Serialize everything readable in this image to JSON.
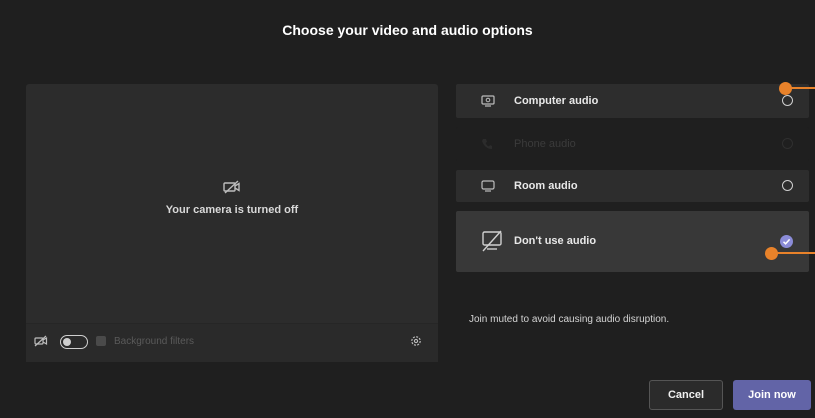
{
  "dialog": {
    "title": "Choose your video and audio options"
  },
  "preview": {
    "camera_status": "Your camera is turned off",
    "background_filter_label": "Background filters"
  },
  "audio_options": [
    {
      "label": "Computer audio",
      "icon": "computer-audio-icon",
      "state": "unselected"
    },
    {
      "label": "Phone audio",
      "icon": "phone-icon",
      "state": "disabled"
    },
    {
      "label": "Room audio",
      "icon": "room-audio-icon",
      "state": "unselected"
    },
    {
      "label": "Don't use audio",
      "icon": "no-audio-icon",
      "state": "selected"
    }
  ],
  "description": "Join muted to avoid causing audio disruption.",
  "buttons": {
    "cancel": "Cancel",
    "join": "Join now"
  },
  "colors": {
    "accent": "#6264a7",
    "selected_radio": "#8b8cd8",
    "callout": "#e8822a",
    "background": "#1f1f1f"
  }
}
